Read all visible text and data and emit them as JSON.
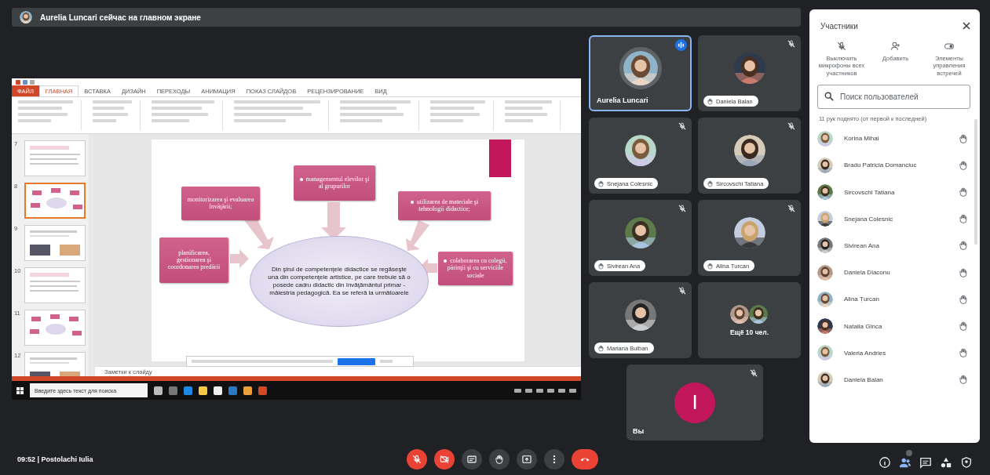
{
  "banner": {
    "text": "Aurelia Luncari сейчас на главном экране"
  },
  "presentation": {
    "file_tab": "ФАЙЛ",
    "ribbon_tabs": [
      {
        "label": "ГЛАВНАЯ",
        "selected": true
      },
      {
        "label": "ВСТАВКА",
        "selected": false
      },
      {
        "label": "ДИЗАЙН",
        "selected": false
      },
      {
        "label": "ПЕРЕХОДЫ",
        "selected": false
      },
      {
        "label": "АНИМАЦИЯ",
        "selected": false
      },
      {
        "label": "ПОКАЗ СЛАЙДОВ",
        "selected": false
      },
      {
        "label": "РЕЦЕНЗИРОВАНИЕ",
        "selected": false
      },
      {
        "label": "ВИД",
        "selected": false
      }
    ],
    "thumbnails": [
      {
        "number": "7",
        "selected": false
      },
      {
        "number": "8",
        "selected": true
      },
      {
        "number": "9",
        "selected": false
      },
      {
        "number": "10",
        "selected": false
      },
      {
        "number": "11",
        "selected": false
      },
      {
        "number": "12",
        "selected": false
      }
    ],
    "slide": {
      "boxes": [
        {
          "text": "monitorizarea şi evaluarea învăţării;",
          "bullet": false
        },
        {
          "text": "managementul elevilor şi al grupurilor",
          "bullet": true
        },
        {
          "text": "utilizarea de materiale şi tehnologii didactice;",
          "bullet": true
        },
        {
          "text": "planificarea, gestionarea şi coordonarea predării",
          "bullet": false
        },
        {
          "text": "colaborarea cu colegii, părinţii şi cu serviciile sociale",
          "bullet": true
        }
      ],
      "center_text": "Din şirul de competenţele didactice se regăseşte una din competenţele artistice, pe care trebuie să o posede cadru didactic din învăţământul primar - măiestria pedagogică. Ea se referă la următoarele"
    },
    "notes_placeholder": "Заметки к слайду",
    "taskbar_search_placeholder": "Введите здесь текст для поиска"
  },
  "tiles": [
    {
      "name": "Aurelia Luncari",
      "kind": "person",
      "selected": true,
      "muted": false,
      "hand_raised": false
    },
    {
      "name": "Daniela Balan",
      "kind": "person",
      "selected": false,
      "muted": true,
      "hand_raised": true
    },
    {
      "name": "Snejana Colesnic",
      "kind": "person",
      "selected": false,
      "muted": true,
      "hand_raised": true
    },
    {
      "name": "Sircovschi Tatiana",
      "kind": "person",
      "selected": false,
      "muted": true,
      "hand_raised": true
    },
    {
      "name": "Sivirean Ana",
      "kind": "person",
      "selected": false,
      "muted": true,
      "hand_raised": true
    },
    {
      "name": "Alina Țurcan",
      "kind": "person",
      "selected": false,
      "muted": true,
      "hand_raised": true
    },
    {
      "name": "Mariana Bulban",
      "kind": "person",
      "selected": false,
      "muted": true,
      "hand_raised": true
    },
    {
      "name": "Ещё 10 чел.",
      "kind": "more"
    },
    {
      "name": "Вы",
      "kind": "self",
      "initial": "I",
      "muted": true
    }
  ],
  "panel": {
    "title": "Участники",
    "actions": [
      {
        "label": "Выключить микрофоны всех участников",
        "kind": "mute"
      },
      {
        "label": "Добавить",
        "kind": "add"
      },
      {
        "label": "Элементы управления встречей",
        "kind": "controls"
      }
    ],
    "search": {
      "placeholder": "Поиск пользователей"
    },
    "hands_note": "11 рук поднято (от первой к последней)",
    "people": [
      {
        "name": "Korina Mihai"
      },
      {
        "name": "Bradu Patricia Domanciuc"
      },
      {
        "name": "Sircovschi Tatiana"
      },
      {
        "name": "Snejana Colesnic"
      },
      {
        "name": "Sivirean Ana"
      },
      {
        "name": "Daniela Diaconu"
      },
      {
        "name": "Alina Țurcan"
      },
      {
        "name": "Natalia Gînca"
      },
      {
        "name": "Valeria Andries"
      },
      {
        "name": "Daniela Balan"
      }
    ]
  },
  "bottom_bar": {
    "meeting": "09:52 | Postolachi Iulia",
    "controls": [
      {
        "kind": "mic",
        "on": false
      },
      {
        "kind": "camera",
        "on": false
      },
      {
        "kind": "captions"
      },
      {
        "kind": "hand"
      },
      {
        "kind": "present"
      },
      {
        "kind": "more"
      },
      {
        "kind": "end"
      }
    ],
    "side": [
      {
        "kind": "info"
      },
      {
        "kind": "people"
      },
      {
        "kind": "chat"
      },
      {
        "kind": "activities"
      },
      {
        "kind": "safety"
      }
    ]
  }
}
